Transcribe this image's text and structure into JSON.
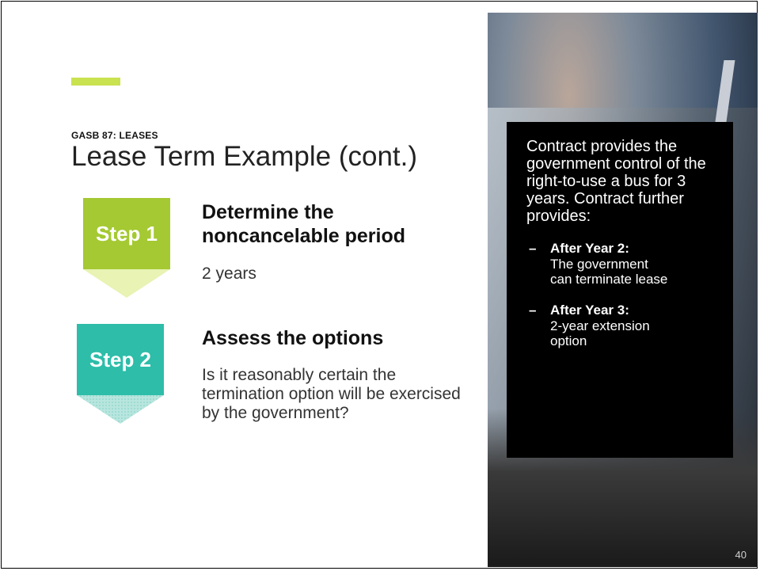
{
  "slide": {
    "kicker": "GASB 87: LEASES",
    "title": "Lease Term Example (cont.)",
    "page_number": "40"
  },
  "steps": [
    {
      "badge": "Step 1",
      "heading": "Determine the noncancelable period",
      "body": "2 years",
      "color": "#a4c932"
    },
    {
      "badge": "Step 2",
      "heading": "Assess the options",
      "body": "Is it reasonably certain the termination option will be exercised by the government?",
      "color": "#2dbda9"
    }
  ],
  "info_box": {
    "intro": "Contract provides the government control of the right-to-use a bus for 3 years. Contract further provides:",
    "bullets": [
      {
        "title": "After Year 2:",
        "text": "The government can terminate lease"
      },
      {
        "title": "After Year 3:",
        "text": "2-year extension option"
      }
    ]
  },
  "colors": {
    "accent_bar": "#c9e24f",
    "step1": "#a4c932",
    "step2": "#2dbda9",
    "info_bg": "#000000"
  }
}
